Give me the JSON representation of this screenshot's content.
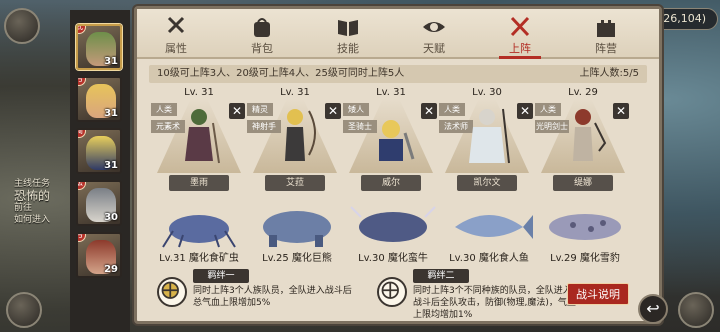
{
  "coords": "(126,104)",
  "background_quest": {
    "label": "主线任务",
    "line1": "恐怖的",
    "line2": "前往",
    "line3": "如何进入"
  },
  "tabs": [
    {
      "label": "属性",
      "icon": "sword-shield-icon"
    },
    {
      "label": "背包",
      "icon": "bag-icon"
    },
    {
      "label": "技能",
      "icon": "book-icon"
    },
    {
      "label": "天赋",
      "icon": "eye-icon"
    },
    {
      "label": "上阵",
      "icon": "crossed-swords-icon",
      "active": true
    },
    {
      "label": "阵营",
      "icon": "castle-icon"
    }
  ],
  "characters": [
    {
      "level": "31",
      "class": "武"
    },
    {
      "level": "31",
      "class": "弓"
    },
    {
      "level": "31",
      "class": "骑"
    },
    {
      "level": "30",
      "class": "法"
    },
    {
      "level": "29",
      "class": "弓"
    }
  ],
  "deploy_rule": "10级可上阵3人、20级可上阵4人、25级可同时上阵5人",
  "deploy_count": "上阵人数:5/5",
  "heroes": [
    {
      "level": "Lv. 31",
      "race": "人类",
      "job": "元素术",
      "name": "墨雨"
    },
    {
      "level": "Lv. 31",
      "race": "精灵",
      "job": "神射手",
      "name": "艾菈"
    },
    {
      "level": "Lv. 31",
      "race": "矮人",
      "job": "圣骑士",
      "name": "威尔"
    },
    {
      "level": "Lv. 30",
      "race": "人类",
      "job": "法术师",
      "name": "凯尔文"
    },
    {
      "level": "Lv. 29",
      "race": "人类",
      "job": "光明剑士",
      "name": "缇娜"
    }
  ],
  "pets": [
    "Lv.31 魔化食矿虫",
    "Lv.25 魔化巨熊",
    "Lv.30 魔化蛮牛",
    "Lv.30 魔化食人鱼",
    "Lv.29 魔化雪豹"
  ],
  "bonds": [
    {
      "title": "羁绊一",
      "line1": "同时上阵3个人族队员，全队进入战斗后",
      "line2": "总气血上限增加5%"
    },
    {
      "title": "羁绊二",
      "line1": "同时上阵3个不同种族的队员，全队进入",
      "line2": "战斗后全队攻击，防御(物理,魔法)，气血",
      "line3": "上限均增加1%"
    }
  ],
  "battle_button": "战斗说明",
  "colors": {
    "accent_red": "#b32e25",
    "panel_bg": "#e6dccb",
    "dark_label": "#3b3530"
  }
}
